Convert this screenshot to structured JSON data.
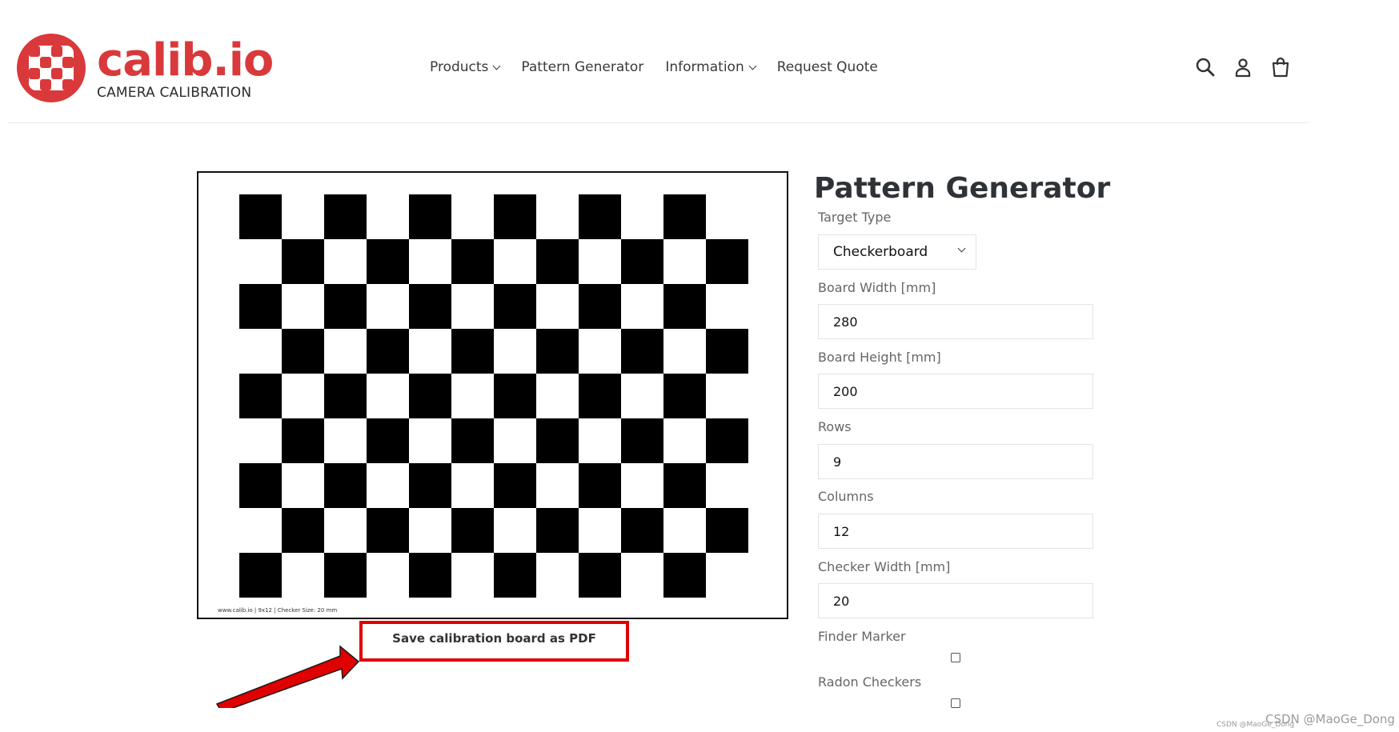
{
  "header": {
    "brand_name": "calib.io",
    "brand_tagline": "CAMERA CALIBRATION",
    "nav": [
      {
        "label": "Products",
        "has_dropdown": true
      },
      {
        "label": "Pattern Generator",
        "has_dropdown": false
      },
      {
        "label": "Information",
        "has_dropdown": true
      },
      {
        "label": "Request Quote",
        "has_dropdown": false
      }
    ],
    "icons": [
      "search-icon",
      "account-icon",
      "cart-icon"
    ]
  },
  "board": {
    "rows": 9,
    "columns": 12,
    "caption": "www.calib.io | 9x12 | Checker Size: 20 mm"
  },
  "save_button_label": "Save calibration board as PDF",
  "form": {
    "title": "Pattern Generator",
    "target_type_label": "Target Type",
    "target_type_value": "Checkerboard",
    "board_width_label": "Board Width [mm]",
    "board_width_value": "280",
    "board_height_label": "Board Height [mm]",
    "board_height_value": "200",
    "rows_label": "Rows",
    "rows_value": "9",
    "columns_label": "Columns",
    "columns_value": "12",
    "checker_width_label": "Checker Width [mm]",
    "checker_width_value": "20",
    "finder_marker_label": "Finder Marker",
    "finder_marker_checked": false,
    "radon_checkers_label": "Radon Checkers",
    "radon_checkers_checked": false
  },
  "watermark": {
    "main": "CSDN @MaoGe_Dong",
    "small": "CSDN @MaoGe_Dong"
  },
  "colors": {
    "brand_red": "#d9393a",
    "highlight_red": "#e00000"
  }
}
